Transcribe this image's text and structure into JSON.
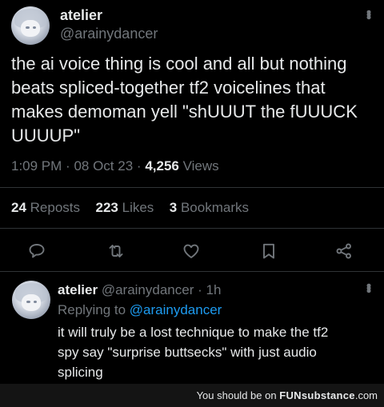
{
  "tweet": {
    "display_name": "atelier",
    "handle": "@arainydancer",
    "text_lines": [
      "the ai voice thing is cool and all but nothing",
      "beats spliced-together tf2 voicelines that",
      "makes demoman yell \"shUUUT the fUUUCK",
      "UUUUP\""
    ],
    "time": "1:09 PM",
    "date": "08 Oct 23",
    "sep": "·",
    "views_count": "4,256",
    "views_label": "Views",
    "stats": {
      "reposts_count": "24",
      "reposts_label": "Reposts",
      "likes_count": "223",
      "likes_label": "Likes",
      "bookmarks_count": "3",
      "bookmarks_label": "Bookmarks"
    }
  },
  "reply": {
    "display_name": "atelier",
    "handle": "@arainydancer",
    "sep": "·",
    "age": "1h",
    "replying_prefix": "Replying to",
    "replying_handle": "@arainydancer",
    "text_lines": [
      "it will truly be a lost technique to make the tf2",
      "spy say \"surprise buttsecks\" with just audio",
      "splicing"
    ]
  },
  "footer": {
    "prefix": "You should be on",
    "brand": "FUNsubstance",
    "suffix": ".com"
  },
  "icons": [
    "more-icon",
    "reply-icon",
    "repost-icon",
    "like-icon",
    "bookmark-icon",
    "share-icon"
  ],
  "colors": {
    "background": "#000000",
    "text": "#e7e9ea",
    "muted": "#71767b",
    "link": "#1d9bf0",
    "divider": "#2f3336"
  }
}
